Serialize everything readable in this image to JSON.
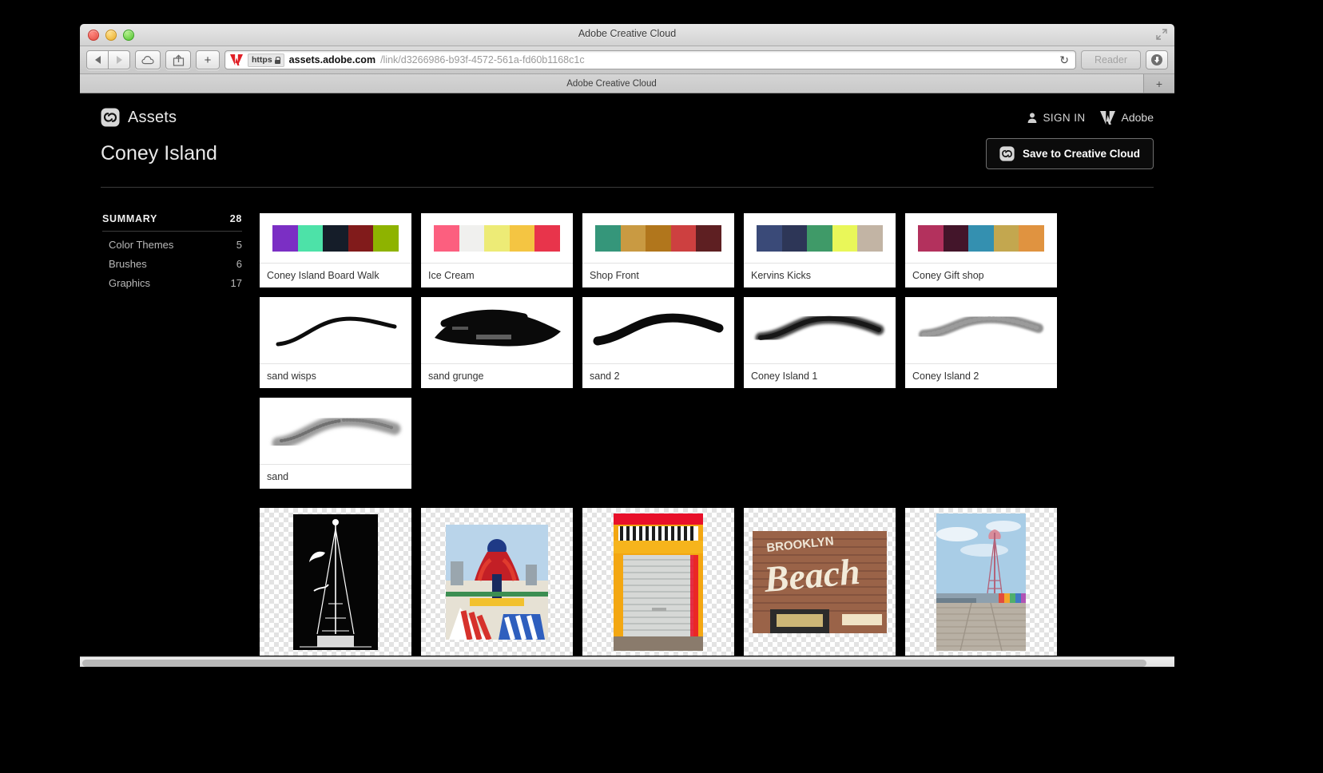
{
  "window": {
    "title": "Adobe Creative Cloud",
    "traffic_lights": [
      "close",
      "minimize",
      "zoom"
    ],
    "toolbar": {
      "back_label": "◀",
      "forward_label": "▶",
      "icloud_icon": "cloud-icon",
      "share_icon": "share-icon",
      "new_tab_label": "+",
      "scheme_label": "https",
      "url_host": "assets.adobe.com",
      "url_path": "/link/d3266986-b93f-4572-561a-fd60b1168c1c",
      "reload_label": "↻",
      "reader_label": "Reader",
      "download_icon": "download-icon"
    },
    "tab": {
      "label": "Adobe Creative Cloud",
      "new_tab_label": "+"
    }
  },
  "header": {
    "brand": "Assets",
    "brand_icon": "creative-cloud-icon",
    "signin_label": "SIGN IN",
    "signin_icon": "person-icon",
    "adobe_label": "Adobe",
    "adobe_icon": "adobe-logo-icon"
  },
  "collection": {
    "title": "Coney Island",
    "save_label": "Save to Creative Cloud",
    "save_icon": "creative-cloud-icon"
  },
  "sidebar": {
    "summary_label": "SUMMARY",
    "summary_count": "28",
    "categories": [
      {
        "label": "Color Themes",
        "count": "5"
      },
      {
        "label": "Brushes",
        "count": "6"
      },
      {
        "label": "Graphics",
        "count": "17"
      }
    ]
  },
  "assets": {
    "color_themes": [
      {
        "label": "Coney Island Board Walk",
        "colors": [
          "#7b2fc4",
          "#4de2a8",
          "#151d29",
          "#811b1b",
          "#8eb300"
        ]
      },
      {
        "label": "Ice Cream",
        "colors": [
          "#fc5f7f",
          "#f0f0ee",
          "#edeb76",
          "#f4c542",
          "#e8344b"
        ]
      },
      {
        "label": "Shop Front",
        "colors": [
          "#35967a",
          "#c99a42",
          "#b1761c",
          "#cd4040",
          "#5e1f22"
        ]
      },
      {
        "label": "Kervins Kicks",
        "colors": [
          "#3a4a78",
          "#2d3657",
          "#3f9a68",
          "#e9f759",
          "#c2b4a4"
        ]
      },
      {
        "label": "Coney Gift shop",
        "colors": [
          "#b3315d",
          "#43152a",
          "#3490b0",
          "#c3a74f",
          "#e09340"
        ]
      }
    ],
    "brushes": [
      {
        "label": "sand wisps",
        "style": "thin-tapered-stroke"
      },
      {
        "label": "sand grunge",
        "style": "thick-grunge-stroke"
      },
      {
        "label": "sand 2",
        "style": "bold-smooth-stroke"
      },
      {
        "label": "Coney Island 1",
        "style": "fuzzy-dark-stroke"
      },
      {
        "label": "Coney Island 2",
        "style": "light-dotted-stroke"
      },
      {
        "label": "sand",
        "style": "soft-grainy-stroke"
      }
    ],
    "graphics": [
      {
        "name": "parachute-jump-sketch"
      },
      {
        "name": "amusement-ride-photo"
      },
      {
        "name": "shop-front-shutter-photo"
      },
      {
        "name": "brooklyn-beach-sign-photo"
      },
      {
        "name": "boardwalk-parachute-jump-photo"
      }
    ]
  },
  "colors": {
    "page_background": "#000000",
    "card_background": "#ffffff",
    "accent_text": "#e9e9e9"
  }
}
